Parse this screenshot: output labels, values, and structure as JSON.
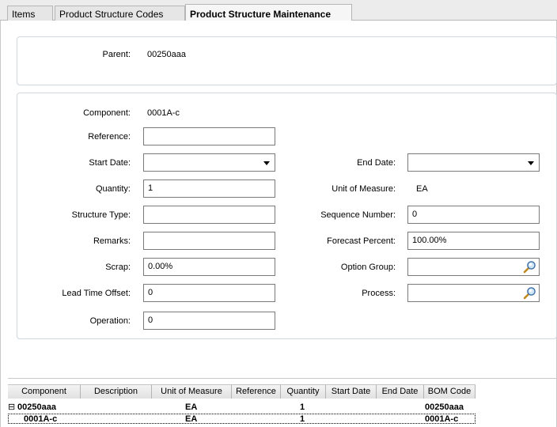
{
  "tabs": [
    {
      "label": "Items"
    },
    {
      "label": "Product Structure Codes"
    },
    {
      "label": "Product Structure Maintenance"
    }
  ],
  "header": {
    "parent_label": "Parent:",
    "parent_value": "00250aaa"
  },
  "form": {
    "component_label": "Component:",
    "component_value": "0001A-c",
    "reference_label": "Reference:",
    "reference_value": "",
    "start_date_label": "Start Date:",
    "start_date_value": "",
    "end_date_label": "End Date:",
    "end_date_value": "",
    "quantity_label": "Quantity:",
    "quantity_value": "1",
    "uom_label": "Unit of Measure:",
    "uom_value": "EA",
    "structure_type_label": "Structure Type:",
    "structure_type_value": "",
    "sequence_number_label": "Sequence Number:",
    "sequence_number_value": "0",
    "remarks_label": "Remarks:",
    "remarks_value": "",
    "forecast_percent_label": "Forecast Percent:",
    "forecast_percent_value": "100.00%",
    "scrap_label": "Scrap:",
    "scrap_value": "0.00%",
    "option_group_label": "Option Group:",
    "option_group_value": "",
    "lead_time_offset_label": "Lead Time Offset:",
    "lead_time_offset_value": "0",
    "process_label": "Process:",
    "process_value": "",
    "operation_label": "Operation:",
    "operation_value": "0"
  },
  "grid": {
    "columns": [
      "Component",
      "Description",
      "Unit of Measure",
      "Reference",
      "Quantity",
      "Start Date",
      "End Date",
      "BOM Code"
    ],
    "rows": [
      {
        "expander": "⊟",
        "component": "00250aaa",
        "uom": "EA",
        "quantity": "1",
        "bom_code": "00250aaa"
      },
      {
        "component": "0001A-c",
        "uom": "EA",
        "quantity": "1",
        "bom_code": "0001A-c"
      }
    ]
  },
  "icons": {
    "dropdown": "chevron-down-icon",
    "lookup": "magnifier-icon"
  }
}
